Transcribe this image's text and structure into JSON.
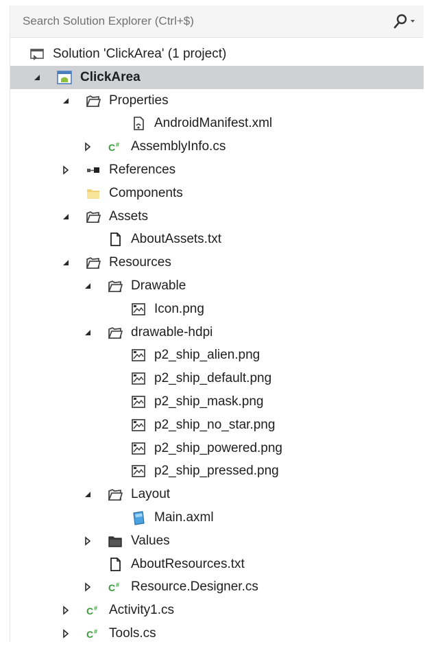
{
  "search": {
    "placeholder": "Search Solution Explorer (Ctrl+$)"
  },
  "tree": [
    {
      "label": "Solution 'ClickArea' (1 project)",
      "level": 0,
      "icon": "solution-icon",
      "arrow": "none"
    },
    {
      "label": "ClickArea",
      "level": 0,
      "icon": "android-project-icon",
      "arrow": "expanded",
      "selected": true
    },
    {
      "label": "Properties",
      "level": 1,
      "icon": "folder-open-icon",
      "arrow": "expanded"
    },
    {
      "label": "AndroidManifest.xml",
      "level": 3,
      "icon": "manifest-file-icon",
      "arrow": "none"
    },
    {
      "label": "AssemblyInfo.cs",
      "level": 2,
      "icon": "csharp-file-icon",
      "arrow": "collapsed"
    },
    {
      "label": "References",
      "level": 1,
      "icon": "references-icon",
      "arrow": "collapsed"
    },
    {
      "label": "Components",
      "level": 1,
      "icon": "components-folder-icon",
      "arrow": "none"
    },
    {
      "label": "Assets",
      "level": 1,
      "icon": "folder-open-icon",
      "arrow": "expanded"
    },
    {
      "label": "AboutAssets.txt",
      "level": 2,
      "icon": "text-file-icon",
      "arrow": "none"
    },
    {
      "label": "Resources",
      "level": 1,
      "icon": "folder-open-icon",
      "arrow": "expanded"
    },
    {
      "label": "Drawable",
      "level": 2,
      "icon": "folder-open-icon",
      "arrow": "expanded"
    },
    {
      "label": "Icon.png",
      "level": 3,
      "icon": "image-file-icon",
      "arrow": "none"
    },
    {
      "label": "drawable-hdpi",
      "level": 2,
      "icon": "folder-open-icon",
      "arrow": "expanded"
    },
    {
      "label": "p2_ship_alien.png",
      "level": 3,
      "icon": "image-file-icon",
      "arrow": "none"
    },
    {
      "label": "p2_ship_default.png",
      "level": 3,
      "icon": "image-file-icon",
      "arrow": "none"
    },
    {
      "label": "p2_ship_mask.png",
      "level": 3,
      "icon": "image-file-icon",
      "arrow": "none"
    },
    {
      "label": "p2_ship_no_star.png",
      "level": 3,
      "icon": "image-file-icon",
      "arrow": "none"
    },
    {
      "label": "p2_ship_powered.png",
      "level": 3,
      "icon": "image-file-icon",
      "arrow": "none"
    },
    {
      "label": "p2_ship_pressed.png",
      "level": 3,
      "icon": "image-file-icon",
      "arrow": "none"
    },
    {
      "label": "Layout",
      "level": 2,
      "icon": "folder-open-icon",
      "arrow": "expanded"
    },
    {
      "label": "Main.axml",
      "level": 3,
      "icon": "axml-file-icon",
      "arrow": "none"
    },
    {
      "label": "Values",
      "level": 2,
      "icon": "folder-closed-icon",
      "arrow": "collapsed"
    },
    {
      "label": "AboutResources.txt",
      "level": 2,
      "icon": "text-file-icon",
      "arrow": "none"
    },
    {
      "label": "Resource.Designer.cs",
      "level": 2,
      "icon": "csharp-file-icon",
      "arrow": "collapsed"
    },
    {
      "label": "Activity1.cs",
      "level": 1,
      "icon": "csharp-file-icon",
      "arrow": "collapsed"
    },
    {
      "label": "Tools.cs",
      "level": 1,
      "icon": "csharp-file-icon",
      "arrow": "collapsed"
    }
  ],
  "colors": {
    "selection": "#cfd1d5",
    "csharp": "#3a9a3a",
    "folder_fill": "#e8e8e8",
    "folder_stroke": "#3a3a3a",
    "components_folder": "#f0d070",
    "android": "#8ec03c"
  }
}
